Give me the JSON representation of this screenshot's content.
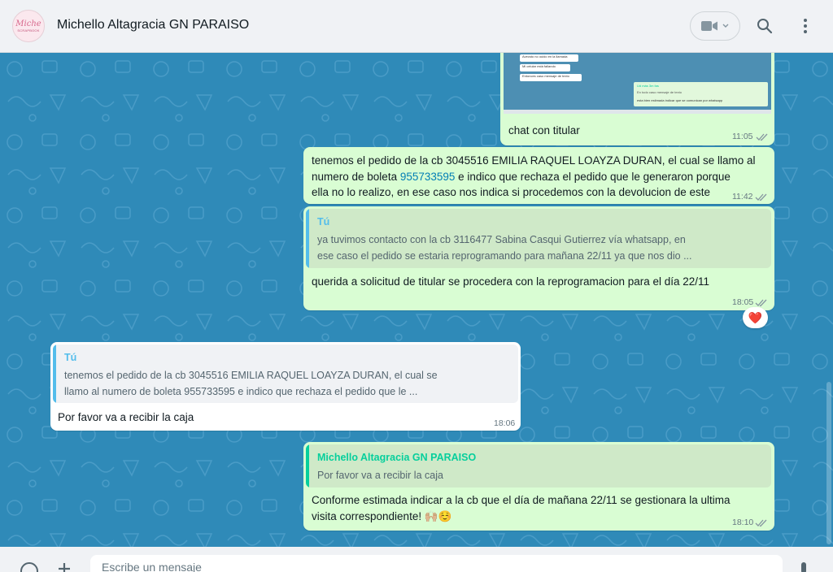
{
  "header": {
    "avatar_line1": "Miche",
    "avatar_line2": "SCRAPBOOK",
    "contact_name": "Michello Altagracia GN PARAISO"
  },
  "messages": [
    {
      "id": "m1",
      "image_lines": [
        "Avecsto no ouido en la llamada",
        "Mi celular está fallando",
        "Entonces caso mensaje de texto",
        "Ud más 3m fas",
        "En todo caso mensaje de texto",
        "esta bien estimada indicar que se comunican por whatsapp"
      ],
      "caption": "chat con titular",
      "time": "11:05"
    },
    {
      "id": "m2",
      "line1": "tenemos el pedido de la cb 3045516 EMILIA RAQUEL LOAYZA DURAN, el cual se llamo al",
      "line2_pre": "numero de boleta ",
      "line2_link": "955733595",
      "line2_post": " e indico que rechaza el pedido que le generaron porque",
      "line3": "ella no lo realizo, en ese caso nos indica si procedemos con la devolucion de este",
      "time": "11:42"
    },
    {
      "id": "m3",
      "quote_author": "Tú",
      "quote_line1": "ya tuvimos contacto con la cb 3116477 Sabina Casqui Gutierrez vía whatsapp, en",
      "quote_line2": "ese caso el pedido se estaria reprogramando para mañana 22/11 ya que nos dio ...",
      "text": "querida a solicitud de titular se procedera con la reprogramacion para el día 22/11",
      "time": "18:05",
      "reaction": "❤️"
    },
    {
      "id": "m4",
      "quote_author": "Tú",
      "quote_line1": "tenemos el pedido de la cb 3045516 EMILIA RAQUEL LOAYZA DURAN, el cual se",
      "quote_line2": "llamo al numero de boleta 955733595 e indico que rechaza el pedido que le ...",
      "text": "Por favor va a recibir la caja",
      "time": "18:06"
    },
    {
      "id": "m5",
      "quote_author": "Michello Altagracia GN PARAISO",
      "quote_line1": "Por favor va a recibir la caja",
      "line1": "Conforme estimada indicar  a la cb que el día de mañana 22/11 se gestionara la ultima",
      "line2": "visita correspondiente! 🙌🏼☺️",
      "time": "18:10"
    }
  ],
  "composer": {
    "placeholder": "Escribe un mensaje"
  },
  "colors": {
    "chat_bg": "#2f8ab8",
    "outgoing_bubble": "#d9fdd3",
    "incoming_bubble": "#ffffff",
    "tick_read": "#8696a0",
    "quote_you": "#53bdeb",
    "quote_contact": "#06cf9c"
  }
}
